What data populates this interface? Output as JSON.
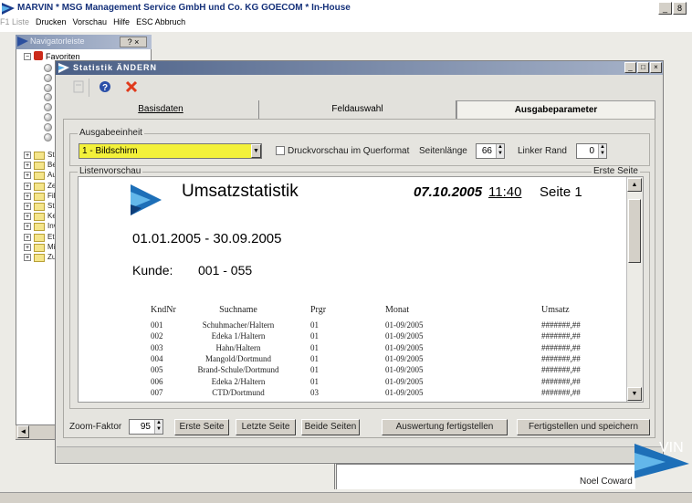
{
  "app": {
    "title": "MARVIN  * MSG Management Service GmbH und Co. KG GOECOM * In-House",
    "window_buttons": [
      "_",
      "8"
    ]
  },
  "menu": {
    "items": [
      {
        "label": "F1 Liste",
        "disabled": true
      },
      {
        "label": "Drucken",
        "disabled": false
      },
      {
        "label": "Vorschau",
        "disabled": false
      },
      {
        "label": "Hilfe",
        "disabled": false
      },
      {
        "label": "ESC Abbruch",
        "disabled": false
      }
    ]
  },
  "navigator": {
    "title": "Navigatorleiste",
    "close_label": "? ×",
    "favorites_label": "Favoriten",
    "tree_labels": [
      "St",
      "Be",
      "Au",
      "Ze",
      "Fil",
      "St",
      "Ke",
      "Inv",
      "Eti",
      "Mi",
      "Zu"
    ],
    "scroll_left": "◄"
  },
  "dialog": {
    "title": "Statistik  ÄNDERN",
    "buttons": [
      "_",
      "□",
      "×"
    ],
    "toolbar": {
      "save_icon": "save-icon",
      "help_icon": "help-icon",
      "cancel_icon": "cancel-icon"
    },
    "tabs": [
      {
        "label": "Basisdaten",
        "active": false
      },
      {
        "label": "Feldauswahl",
        "active": false
      },
      {
        "label": "Ausgabeparameter",
        "active": true
      }
    ],
    "ausgabe": {
      "group_label": "Ausgabeeinheit",
      "selected": "1 - Bildschirm",
      "checkbox_label": "Druckvorschau im Querformat",
      "seitenlaenge_label": "Seitenlänge",
      "seitenlaenge_value": "66",
      "linker_rand_label": "Linker Rand",
      "linker_rand_value": "0"
    },
    "preview": {
      "group_label": "Listenvorschau",
      "page_label": "Erste Seite",
      "report": {
        "title": "Umsatzstatistik",
        "date": "07.10.2005",
        "time": "11:40",
        "page": "Seite  1",
        "range": "01.01.2005  -  30.09.2005",
        "kunde_label": "Kunde:",
        "kunde_value": "001 - 055",
        "columns": [
          "KndNr",
          "Suchname",
          "Prgr",
          "Monat",
          "Umsatz"
        ],
        "rows": [
          [
            "001",
            "Schuhmacher/Haltern",
            "01",
            "01-09/2005",
            "#######,##"
          ],
          [
            "002",
            "Edeka 1/Haltern",
            "01",
            "01-09/2005",
            "#######,##"
          ],
          [
            "003",
            "Hahn/Haltern",
            "01",
            "01-09/2005",
            "#######,##"
          ],
          [
            "004",
            "Mangold/Dortmund",
            "01",
            "01-09/2005",
            "#######,##"
          ],
          [
            "005",
            "Brand-Schule/Dortmund",
            "01",
            "01-09/2005",
            "#######,##"
          ],
          [
            "006",
            "Edeka 2/Haltern",
            "01",
            "01-09/2005",
            "#######,##"
          ],
          [
            "007",
            "CTD/Dortmund",
            "03",
            "01-09/2005",
            "#######,##"
          ]
        ]
      }
    },
    "bottom": {
      "zoom_label": "Zoom-Faktor",
      "zoom_value": "95",
      "erste_seite": "Erste Seite",
      "letzte_seite": "Letzte Seite",
      "beide_seiten": "Beide Seiten",
      "auswertung": "Auswertung fertigstellen",
      "fertig_speichern": "Fertigstellen und speichern"
    }
  },
  "footer": {
    "user": "Noel Coward",
    "logo_text": "VIN"
  },
  "colors": {
    "dialog_title": "#4a5f86",
    "combo_highlight": "#f3f13a",
    "cancel_red": "#e03a1c",
    "help_blue": "#2a4fa8"
  }
}
